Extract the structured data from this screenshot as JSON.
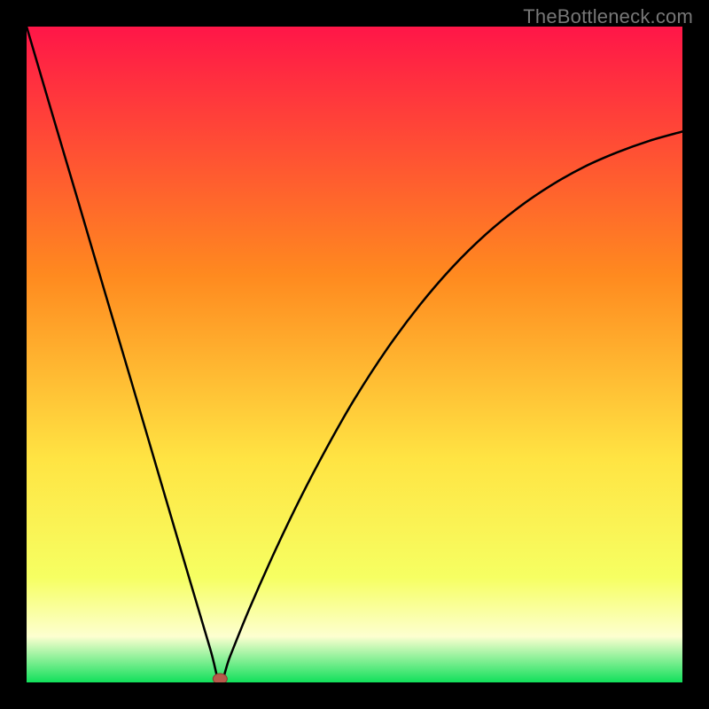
{
  "watermark": "TheBottleneck.com",
  "colors": {
    "frame": "#000000",
    "grad_top": "#ff1648",
    "grad_mid_orange": "#ff8a1f",
    "grad_mid_yellow": "#ffe443",
    "grad_lemon": "#f6ff62",
    "grad_lightyellow": "#fdffd0",
    "grad_green": "#11e05b",
    "curve": "#000000",
    "marker_fill": "#b85a4b",
    "marker_stroke": "#8a3a30"
  },
  "chart_data": {
    "type": "line",
    "title": "",
    "xlabel": "",
    "ylabel": "",
    "xlim": [
      0,
      100
    ],
    "ylim": [
      0,
      100
    ],
    "series": [
      {
        "name": "bottleneck-curve",
        "x": [
          0.0,
          4.0,
          8.0,
          12.0,
          16.0,
          20.0,
          24.0,
          28.0,
          29.5,
          31.0,
          34.0,
          38.0,
          42.0,
          46.0,
          50.0,
          55.0,
          60.0,
          65.0,
          70.0,
          75.0,
          80.0,
          85.0,
          90.0,
          95.0,
          100.0
        ],
        "y": [
          100.0,
          86.4,
          72.9,
          59.3,
          45.8,
          32.2,
          18.6,
          5.1,
          0.0,
          3.9,
          11.3,
          20.3,
          28.6,
          36.2,
          43.2,
          50.9,
          57.6,
          63.4,
          68.3,
          72.4,
          75.8,
          78.6,
          80.8,
          82.6,
          84.0
        ]
      }
    ],
    "annotations": [
      {
        "name": "minimum-marker",
        "x": 29.5,
        "y": 0.0
      }
    ]
  }
}
